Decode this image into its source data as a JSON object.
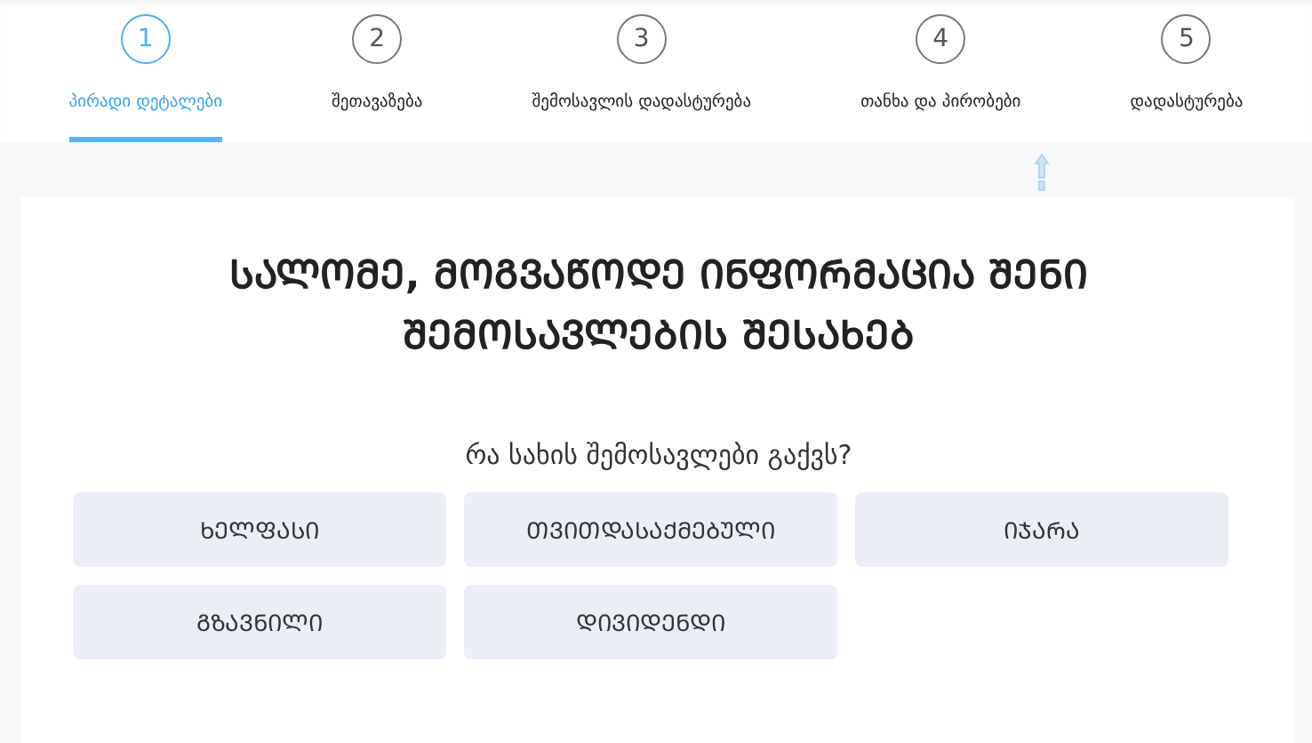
{
  "steps": [
    {
      "number": "1",
      "label": "პირადი დეტალები",
      "selected": true
    },
    {
      "number": "2",
      "label": "შეთავაზება",
      "selected": false
    },
    {
      "number": "3",
      "label": "შემოსავლის დადასტურება",
      "selected": false
    },
    {
      "number": "4",
      "label": "თანხა და პირობები",
      "selected": false
    },
    {
      "number": "5",
      "label": "დადასტურება",
      "selected": false
    }
  ],
  "heading": "ᲡᲐᲚᲝᲛᲔ, ᲛᲝᲒᲕᲐᲬᲝᲓᲔ ᲘᲜᲤᲝᲠᲛᲐᲪᲘᲐ ᲨᲔᲜᲘ ᲨᲔᲛᲝᲡᲐᲕᲚᲔᲑᲘᲡ ᲨᲔᲡᲐᲮᲔᲑ",
  "question": "რა სახის შემოსავლები გაქვს?",
  "options": [
    {
      "label": "ᲮᲔᲚᲤᲐᲡᲘ"
    },
    {
      "label": "ᲗᲕᲘᲗᲓᲐᲡᲐᲥᲛᲔᲑᲣᲚᲘ"
    },
    {
      "label": "ᲘᲯᲐᲠᲐ"
    },
    {
      "label": "ᲒᲖᲐᲕᲜᲘᲚᲘ"
    },
    {
      "label": "ᲓᲘᲕᲘᲓᲔᲜᲓᲘ"
    }
  ]
}
